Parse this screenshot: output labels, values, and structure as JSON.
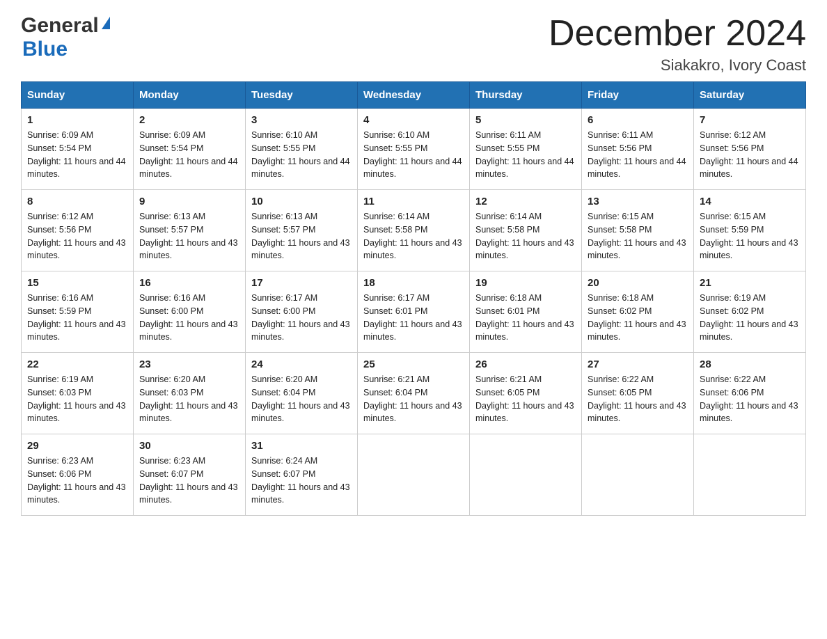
{
  "header": {
    "logo_general": "General",
    "logo_blue": "Blue",
    "title": "December 2024",
    "subtitle": "Siakakro, Ivory Coast"
  },
  "days_of_week": [
    "Sunday",
    "Monday",
    "Tuesday",
    "Wednesday",
    "Thursday",
    "Friday",
    "Saturday"
  ],
  "weeks": [
    [
      {
        "day": "1",
        "sunrise": "6:09 AM",
        "sunset": "5:54 PM",
        "daylight": "11 hours and 44 minutes."
      },
      {
        "day": "2",
        "sunrise": "6:09 AM",
        "sunset": "5:54 PM",
        "daylight": "11 hours and 44 minutes."
      },
      {
        "day": "3",
        "sunrise": "6:10 AM",
        "sunset": "5:55 PM",
        "daylight": "11 hours and 44 minutes."
      },
      {
        "day": "4",
        "sunrise": "6:10 AM",
        "sunset": "5:55 PM",
        "daylight": "11 hours and 44 minutes."
      },
      {
        "day": "5",
        "sunrise": "6:11 AM",
        "sunset": "5:55 PM",
        "daylight": "11 hours and 44 minutes."
      },
      {
        "day": "6",
        "sunrise": "6:11 AM",
        "sunset": "5:56 PM",
        "daylight": "11 hours and 44 minutes."
      },
      {
        "day": "7",
        "sunrise": "6:12 AM",
        "sunset": "5:56 PM",
        "daylight": "11 hours and 44 minutes."
      }
    ],
    [
      {
        "day": "8",
        "sunrise": "6:12 AM",
        "sunset": "5:56 PM",
        "daylight": "11 hours and 43 minutes."
      },
      {
        "day": "9",
        "sunrise": "6:13 AM",
        "sunset": "5:57 PM",
        "daylight": "11 hours and 43 minutes."
      },
      {
        "day": "10",
        "sunrise": "6:13 AM",
        "sunset": "5:57 PM",
        "daylight": "11 hours and 43 minutes."
      },
      {
        "day": "11",
        "sunrise": "6:14 AM",
        "sunset": "5:58 PM",
        "daylight": "11 hours and 43 minutes."
      },
      {
        "day": "12",
        "sunrise": "6:14 AM",
        "sunset": "5:58 PM",
        "daylight": "11 hours and 43 minutes."
      },
      {
        "day": "13",
        "sunrise": "6:15 AM",
        "sunset": "5:58 PM",
        "daylight": "11 hours and 43 minutes."
      },
      {
        "day": "14",
        "sunrise": "6:15 AM",
        "sunset": "5:59 PM",
        "daylight": "11 hours and 43 minutes."
      }
    ],
    [
      {
        "day": "15",
        "sunrise": "6:16 AM",
        "sunset": "5:59 PM",
        "daylight": "11 hours and 43 minutes."
      },
      {
        "day": "16",
        "sunrise": "6:16 AM",
        "sunset": "6:00 PM",
        "daylight": "11 hours and 43 minutes."
      },
      {
        "day": "17",
        "sunrise": "6:17 AM",
        "sunset": "6:00 PM",
        "daylight": "11 hours and 43 minutes."
      },
      {
        "day": "18",
        "sunrise": "6:17 AM",
        "sunset": "6:01 PM",
        "daylight": "11 hours and 43 minutes."
      },
      {
        "day": "19",
        "sunrise": "6:18 AM",
        "sunset": "6:01 PM",
        "daylight": "11 hours and 43 minutes."
      },
      {
        "day": "20",
        "sunrise": "6:18 AM",
        "sunset": "6:02 PM",
        "daylight": "11 hours and 43 minutes."
      },
      {
        "day": "21",
        "sunrise": "6:19 AM",
        "sunset": "6:02 PM",
        "daylight": "11 hours and 43 minutes."
      }
    ],
    [
      {
        "day": "22",
        "sunrise": "6:19 AM",
        "sunset": "6:03 PM",
        "daylight": "11 hours and 43 minutes."
      },
      {
        "day": "23",
        "sunrise": "6:20 AM",
        "sunset": "6:03 PM",
        "daylight": "11 hours and 43 minutes."
      },
      {
        "day": "24",
        "sunrise": "6:20 AM",
        "sunset": "6:04 PM",
        "daylight": "11 hours and 43 minutes."
      },
      {
        "day": "25",
        "sunrise": "6:21 AM",
        "sunset": "6:04 PM",
        "daylight": "11 hours and 43 minutes."
      },
      {
        "day": "26",
        "sunrise": "6:21 AM",
        "sunset": "6:05 PM",
        "daylight": "11 hours and 43 minutes."
      },
      {
        "day": "27",
        "sunrise": "6:22 AM",
        "sunset": "6:05 PM",
        "daylight": "11 hours and 43 minutes."
      },
      {
        "day": "28",
        "sunrise": "6:22 AM",
        "sunset": "6:06 PM",
        "daylight": "11 hours and 43 minutes."
      }
    ],
    [
      {
        "day": "29",
        "sunrise": "6:23 AM",
        "sunset": "6:06 PM",
        "daylight": "11 hours and 43 minutes."
      },
      {
        "day": "30",
        "sunrise": "6:23 AM",
        "sunset": "6:07 PM",
        "daylight": "11 hours and 43 minutes."
      },
      {
        "day": "31",
        "sunrise": "6:24 AM",
        "sunset": "6:07 PM",
        "daylight": "11 hours and 43 minutes."
      },
      null,
      null,
      null,
      null
    ]
  ]
}
